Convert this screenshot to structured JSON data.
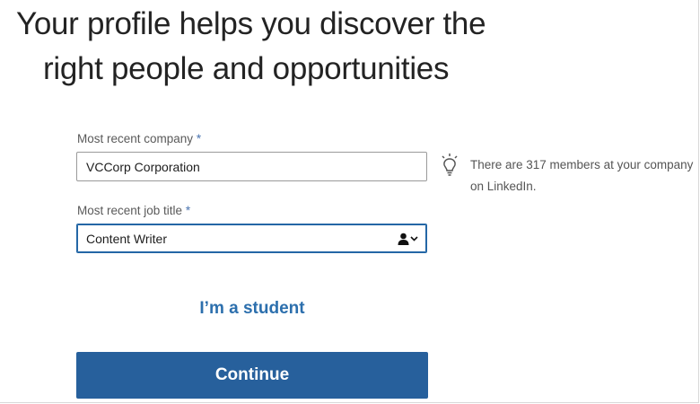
{
  "headline": {
    "line1": "Your profile helps you discover the",
    "line2": "right people and opportunities"
  },
  "company": {
    "label": "Most recent company",
    "required_mark": "*",
    "value": "VCCorp Corporation"
  },
  "hint": {
    "icon": "lightbulb-icon",
    "text": "There are 317 members at your company on LinkedIn."
  },
  "job_title": {
    "label": "Most recent job title",
    "required_mark": "*",
    "value": "Content Writer",
    "addon_icon": "person-icon"
  },
  "student_link": "I’m a student",
  "continue_button": "Continue",
  "colors": {
    "primary": "#27609c",
    "link": "#2c6fad",
    "focus_border": "#2467a6"
  }
}
